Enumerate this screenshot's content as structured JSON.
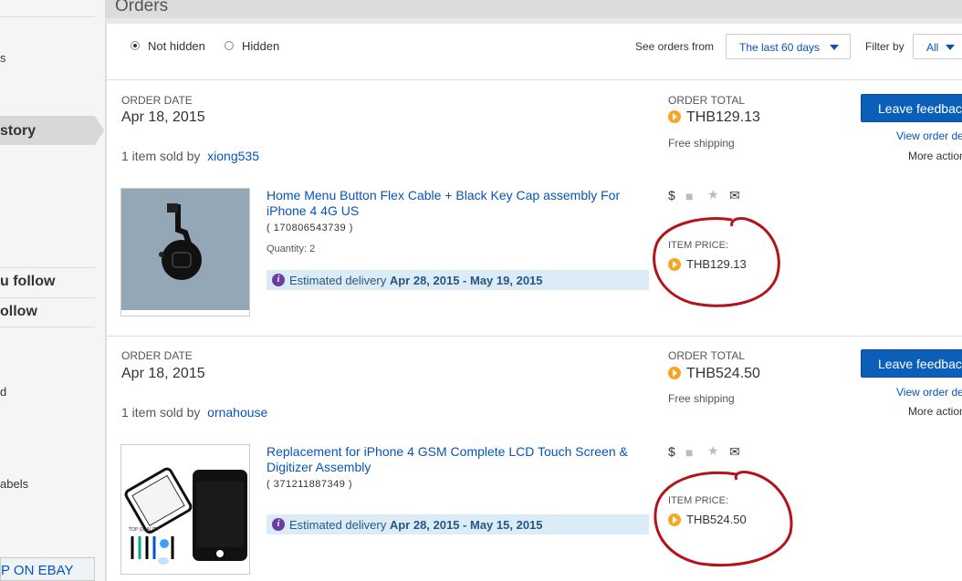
{
  "header": {
    "title": "Orders"
  },
  "sidebar": {
    "items": [
      {
        "label": "s"
      },
      {
        "label": "story"
      },
      {
        "label": "u follow"
      },
      {
        "label": "ollow"
      },
      {
        "label": "d"
      },
      {
        "label": "abels"
      }
    ],
    "shop_label": "P ON EBAY"
  },
  "filters": {
    "radio_not_hidden": "Not hidden",
    "radio_hidden": "Hidden",
    "see_orders_from_label": "See orders from",
    "period_value": "The last 60 days",
    "filter_by_label": "Filter by",
    "filter_value": "All"
  },
  "orders": [
    {
      "date_label": "ORDER DATE",
      "date": "Apr 18, 2015",
      "total_label": "ORDER TOTAL",
      "total": "THB129.13",
      "shipping": "Free shipping",
      "feedback_button": "Leave feedback",
      "view_details": "View order details",
      "more_actions": "More actions",
      "sold_prefix": "1 item sold by",
      "seller": "xiong535",
      "item_title": "Home Menu Button Flex Cable + Black Key Cap assembly For iPhone 4 4G US",
      "item_number": "( 170806543739 )",
      "quantity": "Quantity: 2",
      "delivery_prefix": "Estimated delivery",
      "delivery_range": "Apr 28, 2015 - May 19, 2015",
      "price_label": "ITEM PRICE:",
      "price": "THB129.13"
    },
    {
      "date_label": "ORDER DATE",
      "date": "Apr 18, 2015",
      "total_label": "ORDER TOTAL",
      "total": "THB524.50",
      "shipping": "Free shipping",
      "feedback_button": "Leave feedback",
      "view_details": "View order details",
      "more_actions": "More actions",
      "sold_prefix": "1 item sold by",
      "seller": "ornahouse",
      "item_title": "Replacement for iPhone 4 GSM Complete LCD Touch Screen & Digitizer Assembly",
      "item_number": "( 371211887349 )",
      "delivery_prefix": "Estimated delivery",
      "delivery_range": "Apr 28, 2015 - May 15, 2015",
      "price_label": "ITEM PRICE:",
      "price": "THB524.50",
      "thumb_caption": "TOP QUALITY"
    }
  ],
  "colors": {
    "link": "#0654ba",
    "button": "#0c5fb8",
    "annotation": "#b3141b",
    "paypal": "#f5a623"
  }
}
